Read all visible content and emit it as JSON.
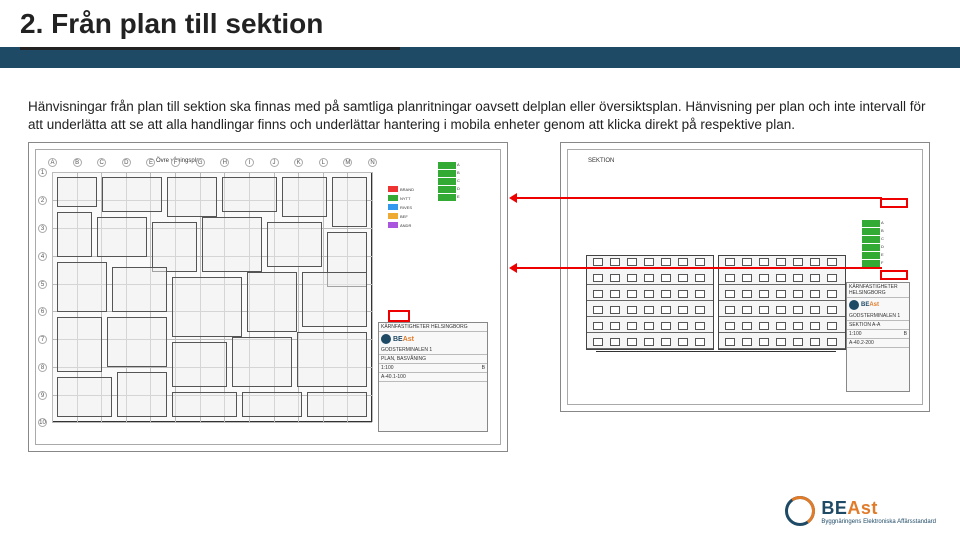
{
  "title": "2. Från plan till sektion",
  "body_text": "Hänvisningar från plan till sektion ska finnas med på samtliga planritningar oavsett delplan eller översiktsplan. Hänvisning per plan och inte intervall för att underlätta att se att alla handlingar finns och underlättar hantering i mobila enheter genom att klicka direkt på respektive plan.",
  "drawing_left": {
    "header_annot": "Övre våningsplan",
    "grid_cols": [
      "A",
      "B",
      "C",
      "D",
      "E",
      "F",
      "G",
      "H",
      "I",
      "J",
      "K",
      "L",
      "M",
      "N"
    ],
    "grid_rows": [
      "1",
      "2",
      "3",
      "4",
      "5",
      "6",
      "7",
      "8",
      "9",
      "10"
    ],
    "title_block": {
      "logo": "BEAst",
      "line1": "KÄRNFASTIGHETER HELSINGBORG",
      "line2": "GODSTERMINALEN 1",
      "line3": "PLAN, BASVÅNING",
      "scale": "1:100",
      "drawing_no": "A-40.1-100",
      "rev": "B"
    },
    "legend": [
      {
        "color": "#e33",
        "label": "BRAND"
      },
      {
        "color": "#3a3",
        "label": "NYTT"
      },
      {
        "color": "#39e",
        "label": "RIVES"
      },
      {
        "color": "#ea3",
        "label": "BEF"
      },
      {
        "color": "#a5d",
        "label": "ÄNDR"
      }
    ],
    "revisions": [
      "A",
      "B",
      "C",
      "D",
      "E"
    ]
  },
  "drawing_right": {
    "header_annot": "SEKTION",
    "title_block": {
      "logo": "BEAst",
      "line1": "KÄRNFASTIGHETER HELSINGBORG",
      "line2": "GODSTERMINALEN 1",
      "line3": "SEKTION A-A",
      "scale": "1:100",
      "drawing_no": "A-40.2-200",
      "rev": "B"
    },
    "revisions": [
      "A",
      "B",
      "C",
      "D",
      "E",
      "F"
    ]
  },
  "footer": {
    "logo": "BEAst",
    "tagline": "Byggnäringens Elektroniska Affärsstandard"
  }
}
